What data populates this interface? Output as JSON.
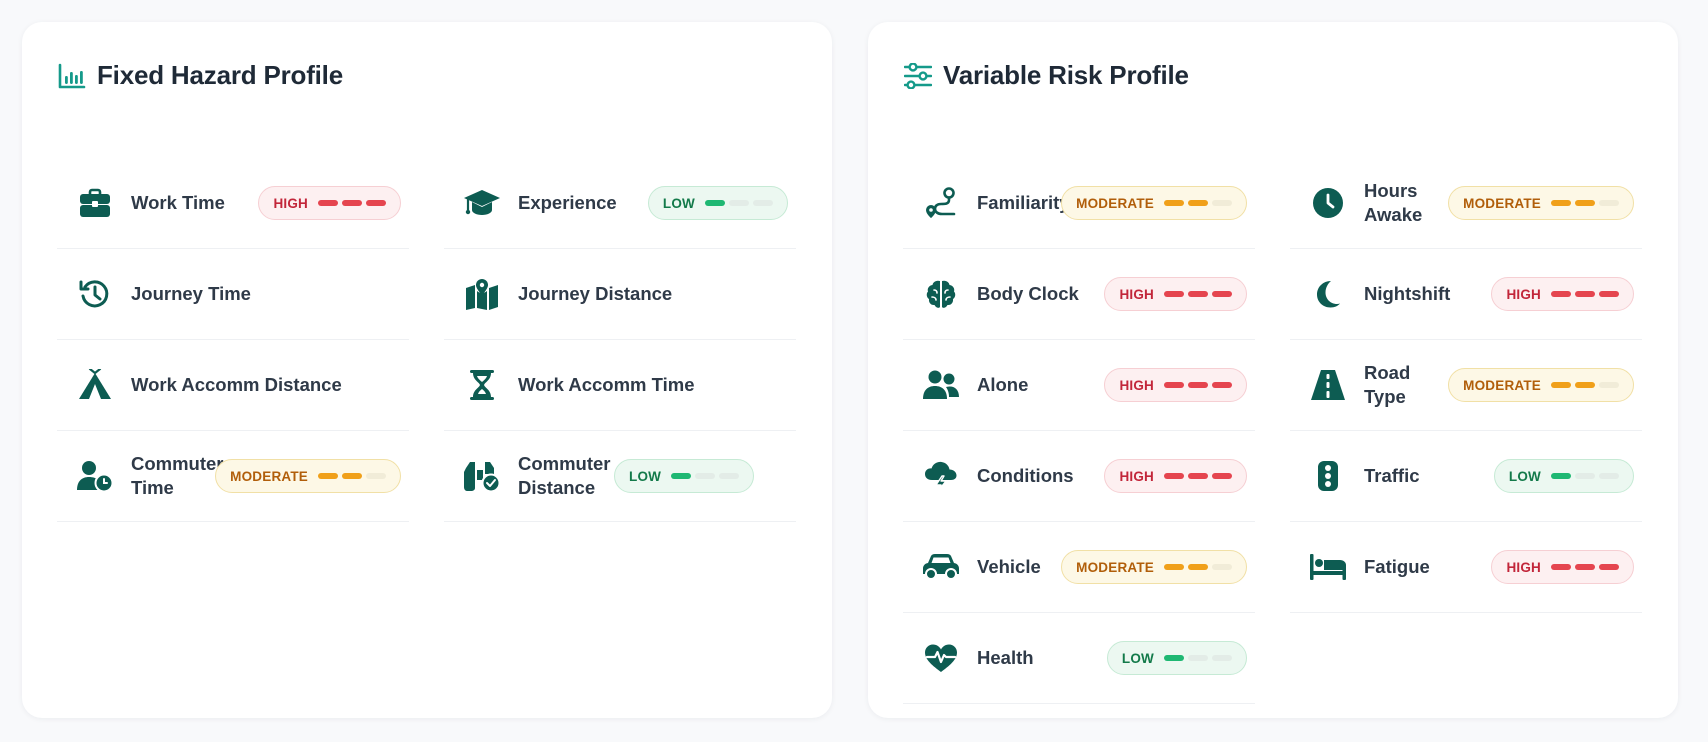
{
  "colors": {
    "icon": "#0d5c52",
    "header_icon": "#159a8a",
    "high": "#e5454f",
    "moderate": "#f0a01a",
    "low": "#1fb873"
  },
  "fixed": {
    "title": "Fixed Hazard Profile",
    "header_icon": "bar-chart-icon",
    "items": [
      {
        "label": "Work Time",
        "icon": "briefcase-icon",
        "level": "HIGH",
        "filled": 3
      },
      {
        "label": "Experience",
        "icon": "graduation-cap-icon",
        "level": "LOW",
        "filled": 1
      },
      {
        "label": "Journey Time",
        "icon": "history-icon",
        "level": "",
        "filled": 0
      },
      {
        "label": "Journey Distance",
        "icon": "map-icon",
        "level": "",
        "filled": 0
      },
      {
        "label": "Work Accomm Distance",
        "icon": "tent-icon",
        "level": "",
        "filled": 0
      },
      {
        "label": "Work Accomm Time",
        "icon": "hourglass-icon",
        "level": "",
        "filled": 0
      },
      {
        "label": "Commuter Time",
        "icon": "user-clock-icon",
        "level": "MODERATE",
        "filled": 2
      },
      {
        "label": "Commuter Distance",
        "icon": "binoculars-check-icon",
        "level": "LOW",
        "filled": 1
      }
    ]
  },
  "variable": {
    "title": "Variable Risk Profile",
    "header_icon": "sliders-icon",
    "items": [
      {
        "label": "Familiarity",
        "icon": "route-icon",
        "level": "MODERATE",
        "filled": 2
      },
      {
        "label": "Hours Awake",
        "icon": "clock-icon",
        "level": "MODERATE",
        "filled": 2
      },
      {
        "label": "Body Clock",
        "icon": "brain-icon",
        "level": "HIGH",
        "filled": 3
      },
      {
        "label": "Nightshift",
        "icon": "moon-icon",
        "level": "HIGH",
        "filled": 3
      },
      {
        "label": "Alone",
        "icon": "users-icon",
        "level": "HIGH",
        "filled": 3
      },
      {
        "label": "Road Type",
        "icon": "road-icon",
        "level": "MODERATE",
        "filled": 2
      },
      {
        "label": "Conditions",
        "icon": "storm-cloud-icon",
        "level": "HIGH",
        "filled": 3
      },
      {
        "label": "Traffic",
        "icon": "traffic-light-icon",
        "level": "LOW",
        "filled": 1
      },
      {
        "label": "Vehicle",
        "icon": "car-icon",
        "level": "MODERATE",
        "filled": 2
      },
      {
        "label": "Fatigue",
        "icon": "bed-icon",
        "level": "HIGH",
        "filled": 3
      },
      {
        "label": "Health",
        "icon": "heart-pulse-icon",
        "level": "LOW",
        "filled": 1
      }
    ]
  }
}
